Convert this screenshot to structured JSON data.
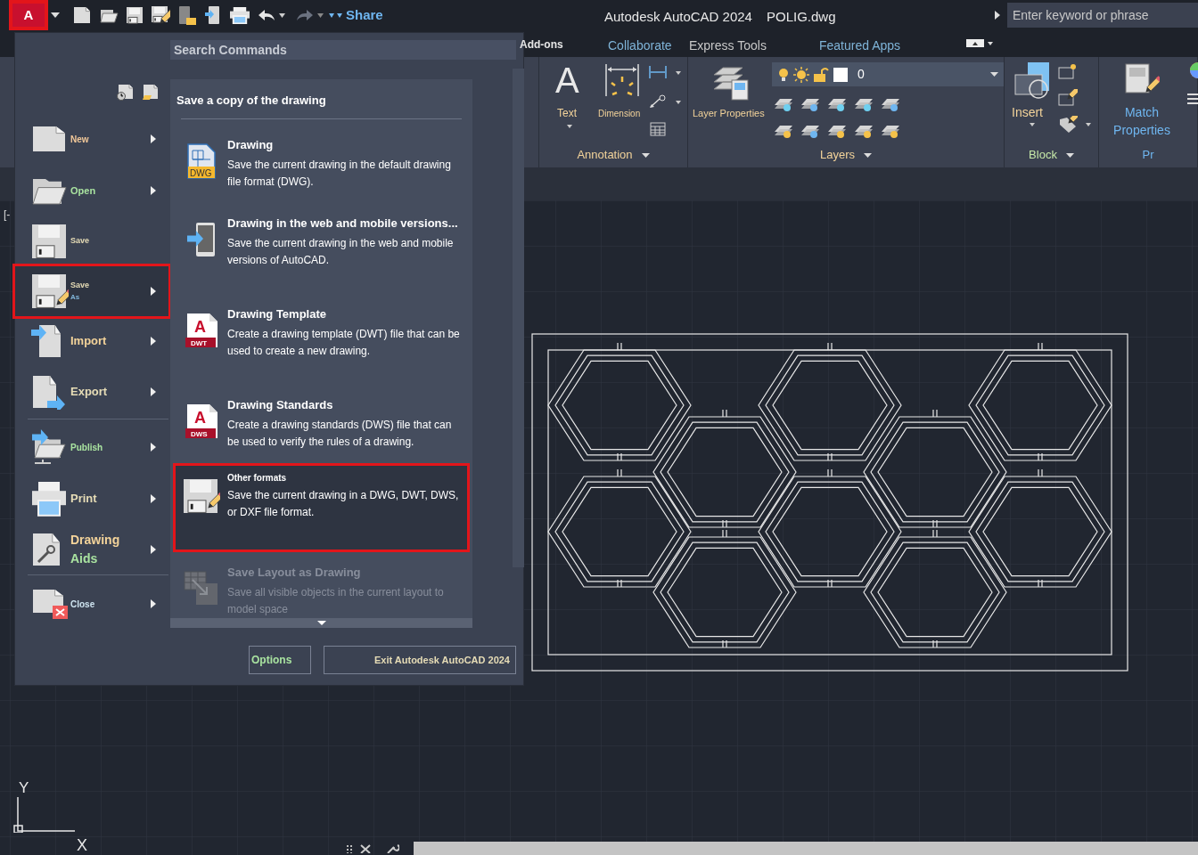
{
  "title_bar": {
    "app_button": {
      "label": "A",
      "highlighted": true
    },
    "share": "Share",
    "app_title": "Autodesk AutoCAD 2024",
    "file_name": "POLIG.dwg",
    "search": {
      "placeholder": "Enter keyword or phrase"
    }
  },
  "ribbon_tabs": [
    {
      "label": "Add-ons",
      "selected": false
    },
    {
      "label": "Collaborate",
      "selected": false
    },
    {
      "label": "Express Tools",
      "selected": false
    },
    {
      "label": "Featured Apps",
      "selected": false
    }
  ],
  "ribbon_panels": [
    {
      "title": "Annotation",
      "tools": [
        "Text",
        "Dimension"
      ],
      "text_icon_glyph": "A"
    },
    {
      "title": "Layers",
      "tools": [
        "Layer Properties"
      ],
      "layer_dropdown": "0"
    },
    {
      "title": "Block",
      "tools": [
        "Insert"
      ]
    },
    {
      "title": "Pr",
      "tools": [
        "Match Properties"
      ]
    }
  ],
  "viewport_label": "[-",
  "app_menu": {
    "search": {
      "placeholder": "Search Commands"
    },
    "items": [
      {
        "label": "New",
        "selected": false,
        "has_submenu": true,
        "highlighted": false
      },
      {
        "label": "Open",
        "selected": false,
        "has_submenu": true,
        "highlighted": false
      },
      {
        "label": "Save",
        "selected": false,
        "has_submenu": false,
        "highlighted": false
      },
      {
        "label": "Save",
        "label_2": "As",
        "selected": true,
        "has_submenu": true,
        "highlighted": true
      },
      {
        "label": "Import",
        "selected": false,
        "has_submenu": true,
        "highlighted": false
      },
      {
        "label": "Export",
        "selected": false,
        "has_submenu": true,
        "highlighted": false
      },
      {
        "label": "Publish",
        "selected": false,
        "has_submenu": true,
        "highlighted": false
      },
      {
        "label": "Print",
        "selected": false,
        "has_submenu": true,
        "highlighted": false
      },
      {
        "label": "Drawing",
        "label_2": "Aids",
        "selected": false,
        "has_submenu": true,
        "highlighted": false
      },
      {
        "label": "Close",
        "selected": false,
        "has_submenu": true,
        "highlighted": false
      }
    ],
    "submenu": {
      "heading": "Save a copy of the drawing",
      "items": [
        {
          "title": "Drawing",
          "badge": "DWG",
          "description": "Save the current drawing in the default drawing file format (DWG).",
          "selected": false,
          "disabled": false,
          "highlighted": false
        },
        {
          "title": "Drawing in the web and mobile versions...",
          "description": "Save the current drawing in the web and mobile versions of AutoCAD.",
          "selected": false,
          "disabled": false,
          "highlighted": false
        },
        {
          "title": "Drawing Template",
          "icon_letter": "A",
          "badge": "DWT",
          "description": "Create a drawing template (DWT) file that can be used to create a new drawing.",
          "selected": false,
          "disabled": false,
          "highlighted": false
        },
        {
          "title": "Drawing Standards",
          "icon_letter": "A",
          "badge": "DWS",
          "description": "Create a drawing standards (DWS) file that can be used to verify the rules of a drawing.",
          "selected": false,
          "disabled": false,
          "highlighted": false
        },
        {
          "title": "Other formats",
          "description": "Save the current drawing in a DWG, DWT, DWS, or DXF file format.",
          "selected": true,
          "disabled": false,
          "highlighted": true
        },
        {
          "title": "Save Layout as Drawing",
          "description": "Save all visible objects in the current layout to model space",
          "selected": false,
          "disabled": true,
          "highlighted": false
        }
      ]
    },
    "buttons": [
      "Options",
      "Exit Autodesk AutoCAD 2024"
    ]
  },
  "ucs": {
    "y_label": "Y",
    "x_label": "X"
  }
}
